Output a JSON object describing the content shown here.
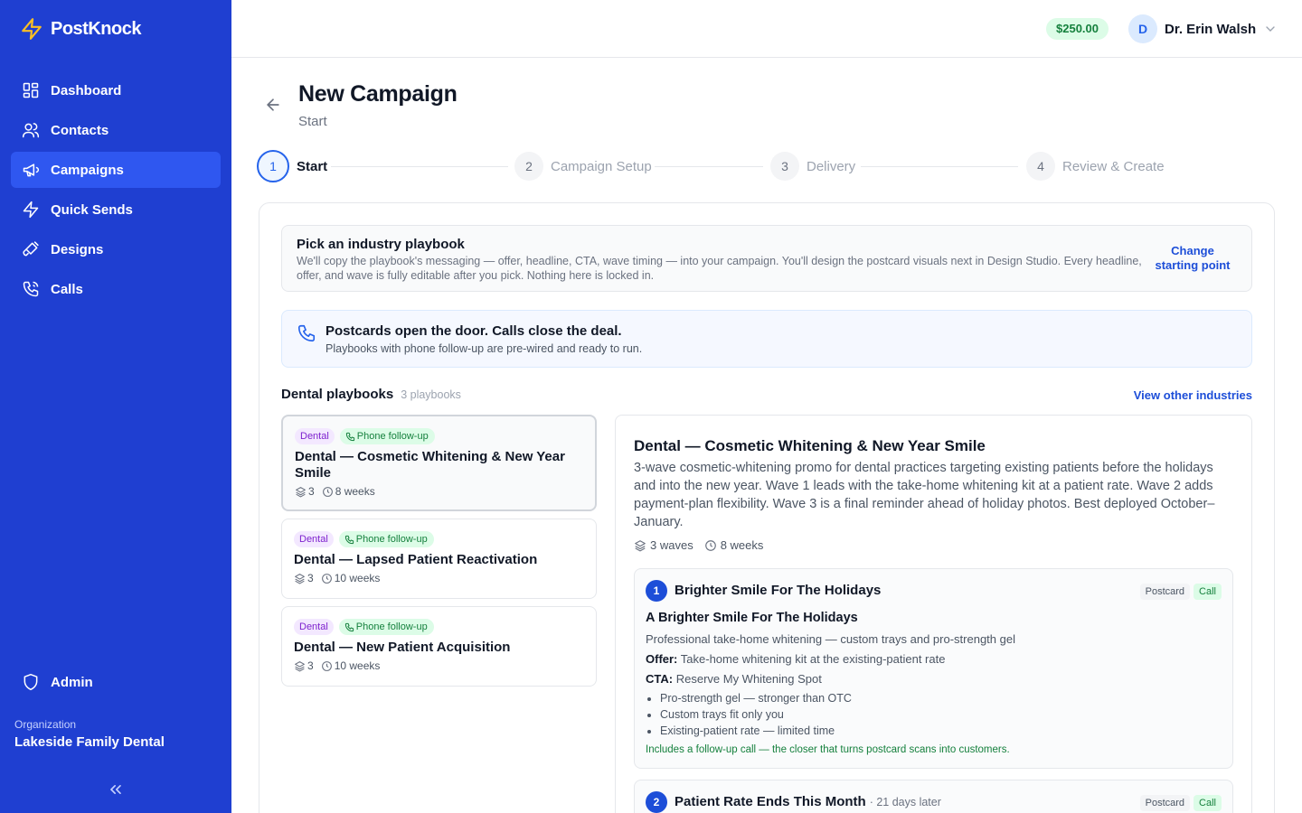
{
  "app": {
    "name": "PostKnock"
  },
  "sidebar": {
    "items": [
      {
        "label": "Dashboard",
        "icon": "dashboard-icon"
      },
      {
        "label": "Contacts",
        "icon": "users-icon"
      },
      {
        "label": "Campaigns",
        "icon": "megaphone-icon",
        "active": true
      },
      {
        "label": "Quick Sends",
        "icon": "lightning-icon"
      },
      {
        "label": "Designs",
        "icon": "paint-brush-icon"
      },
      {
        "label": "Calls",
        "icon": "phone-icon"
      }
    ],
    "admin_label": "Admin",
    "org_label": "Organization",
    "org_name": "Lakeside Family Dental",
    "accent": "#1f3fd1"
  },
  "header": {
    "balance": "$250.00",
    "user_initial": "D",
    "user_name": "Dr. Erin Walsh"
  },
  "page": {
    "title": "New Campaign",
    "subtitle": "Start"
  },
  "steps": [
    {
      "num": "1",
      "label": "Start",
      "active": true
    },
    {
      "num": "2",
      "label": "Campaign Setup"
    },
    {
      "num": "3",
      "label": "Delivery"
    },
    {
      "num": "4",
      "label": "Review & Create"
    }
  ],
  "pick": {
    "title": "Pick an industry playbook",
    "description": "We'll copy the playbook's messaging — offer, headline, CTA, wave timing — into your campaign. You'll design the postcard visuals next in Design Studio. Every headline, offer, and wave is fully editable after you pick. Nothing here is locked in.",
    "change_link": "Change starting point"
  },
  "banner": {
    "title": "Postcards open the door. Calls close the deal.",
    "subtitle": "Playbooks with phone follow-up are pre-wired and ready to run."
  },
  "playbooks_section": {
    "title": "Dental playbooks",
    "count": "3 playbooks",
    "other_link": "View other industries"
  },
  "playbooks": [
    {
      "industry": "Dental",
      "phone_tag": "Phone follow-up",
      "name": "Dental — Cosmetic Whitening & New Year Smile",
      "waves": "3",
      "duration": "8 weeks",
      "selected": true
    },
    {
      "industry": "Dental",
      "phone_tag": "Phone follow-up",
      "name": "Dental — Lapsed Patient Reactivation",
      "waves": "3",
      "duration": "10 weeks"
    },
    {
      "industry": "Dental",
      "phone_tag": "Phone follow-up",
      "name": "Dental — New Patient Acquisition",
      "waves": "3",
      "duration": "10 weeks"
    }
  ],
  "detail": {
    "title": "Dental — Cosmetic Whitening & New Year Smile",
    "description": "3-wave cosmetic-whitening promo for dental practices targeting existing patients before the holidays and into the new year. Wave 1 leads with the take-home whitening kit at a patient rate. Wave 2 adds payment-plan flexibility. Wave 3 is a final reminder ahead of holiday photos. Best deployed October–January.",
    "waves_text": "3 waves",
    "duration_text": "8 weeks",
    "waves": [
      {
        "num": "1",
        "name": "Brighter Smile For The Holidays",
        "badge_postcard": "Postcard",
        "badge_call": "Call",
        "headline": "A Brighter Smile For The Holidays",
        "subline": "Professional take-home whitening — custom trays and pro-strength gel",
        "offer_label": "Offer:",
        "offer": "Take-home whitening kit at the existing-patient rate",
        "cta_label": "CTA:",
        "cta": "Reserve My Whitening Spot",
        "bullets": [
          "Pro-strength gel — stronger than OTC",
          "Custom trays fit only you",
          "Existing-patient rate — limited time"
        ],
        "note": "Includes a follow-up call — the closer that turns postcard scans into customers."
      },
      {
        "num": "2",
        "name": "Patient Rate Ends This Month",
        "later": "· 21 days later",
        "badge_postcard": "Postcard",
        "badge_call": "Call"
      }
    ]
  }
}
